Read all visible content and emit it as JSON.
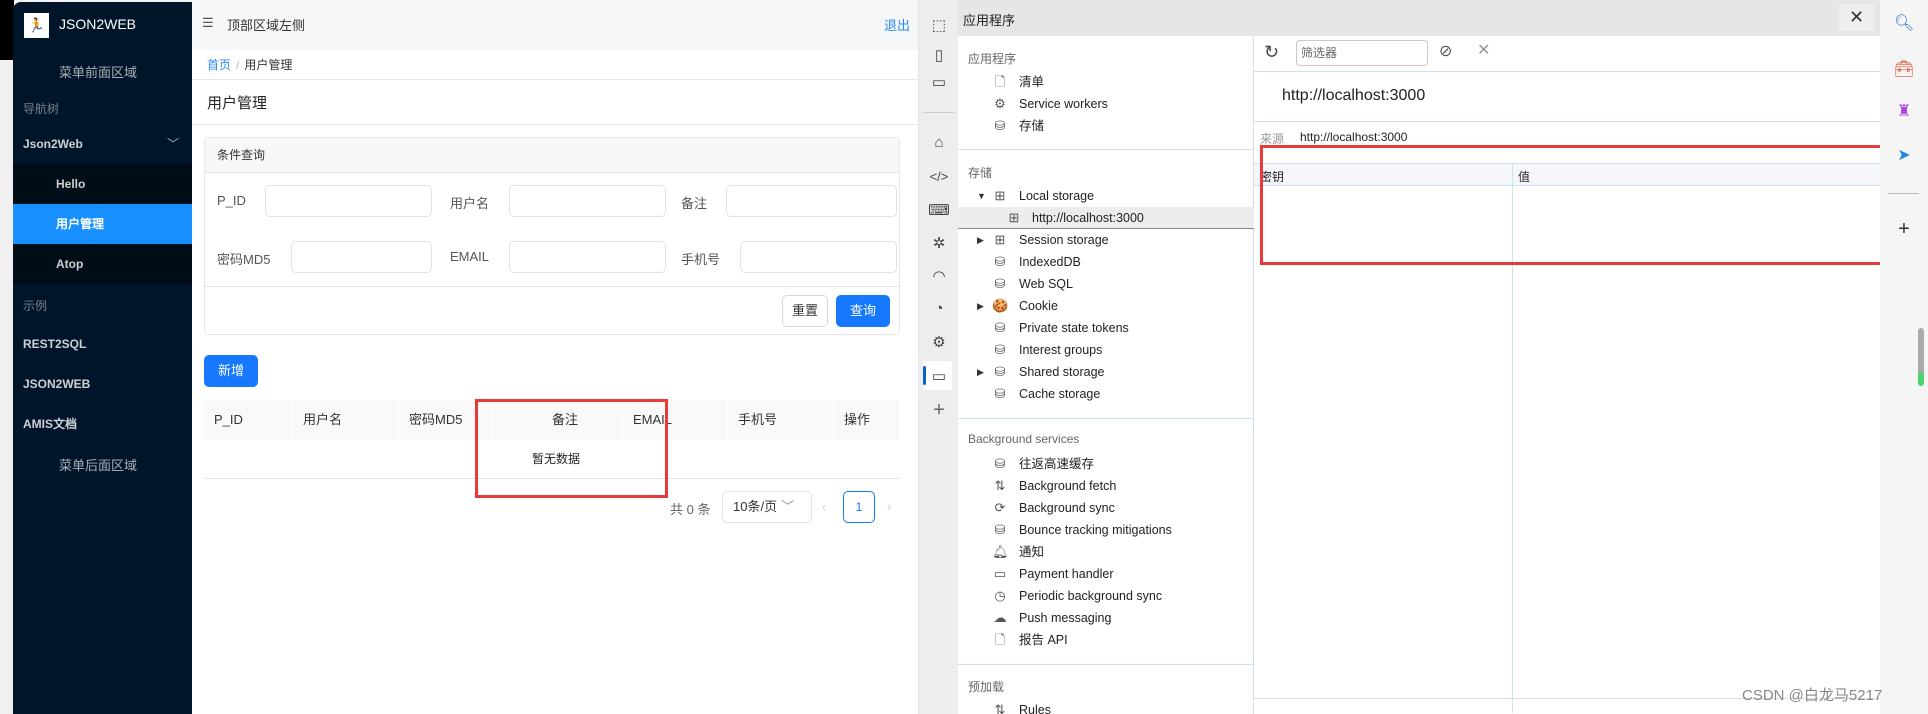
{
  "app": {
    "brand": "JSON2WEB",
    "menu_front": "菜单前面区域",
    "menu_back": "菜单后面区域",
    "nav_group": "导航树",
    "nav_parent": "Json2Web",
    "nav_children": [
      "Hello",
      "用户管理",
      "Atop"
    ],
    "examples_group": "示例",
    "examples": [
      "REST2SQL",
      "JSON2WEB",
      "AMIS文档"
    ],
    "topbar_title": "顶部区域左侧",
    "logout": "退出",
    "breadcrumb": {
      "home": "首页",
      "sep": "/",
      "current": "用户管理"
    },
    "page_title": "用户管理",
    "query_panel": {
      "title": "条件查询",
      "fields": [
        {
          "label": "P_ID",
          "value": ""
        },
        {
          "label": "用户名",
          "value": ""
        },
        {
          "label": "备注",
          "value": ""
        },
        {
          "label": "密码MD5",
          "value": ""
        },
        {
          "label": "EMAIL",
          "value": ""
        },
        {
          "label": "手机号",
          "value": ""
        }
      ],
      "reset": "重置",
      "search": "查询"
    },
    "add_button": "新增",
    "table": {
      "columns": [
        "P_ID",
        "用户名",
        "密码MD5",
        "备注",
        "EMAIL",
        "手机号",
        "操作"
      ],
      "empty": "暂无数据"
    },
    "pager": {
      "total": "共 0 条",
      "page_size": "10条/页",
      "current_page": "1"
    }
  },
  "devtools": {
    "panel_title": "应用程序",
    "section_app": "应用程序",
    "app_items": [
      "清单",
      "Service workers",
      "存储"
    ],
    "section_storage": "存储",
    "storage_items": [
      {
        "label": "Local storage",
        "expanded": true
      },
      {
        "label": "http://localhost:3000",
        "selected": true
      },
      {
        "label": "Session storage"
      },
      {
        "label": "IndexedDB"
      },
      {
        "label": "Web SQL"
      },
      {
        "label": "Cookie"
      },
      {
        "label": "Private state tokens"
      },
      {
        "label": "Interest groups"
      },
      {
        "label": "Shared storage"
      },
      {
        "label": "Cache storage"
      }
    ],
    "section_bg": "Background services",
    "bg_items": [
      "往返高速缓存",
      "Background fetch",
      "Background sync",
      "Bounce tracking mitigations",
      "通知",
      "Payment handler",
      "Periodic background sync",
      "Push messaging",
      "报告 API"
    ],
    "section_preload": "预加载",
    "preload_items": [
      "Rules"
    ],
    "filter_placeholder": "筛选器",
    "origin_title": "http://localhost:3000",
    "origin_label": "来源",
    "origin_value": "http://localhost:3000",
    "kv_columns": {
      "key": "密钥",
      "value": "值"
    }
  },
  "watermark": "CSDN @白龙马5217",
  "colors": {
    "primary": "#1677ff",
    "sidebar": "#001529",
    "highlight_box": "#e83a3a"
  }
}
